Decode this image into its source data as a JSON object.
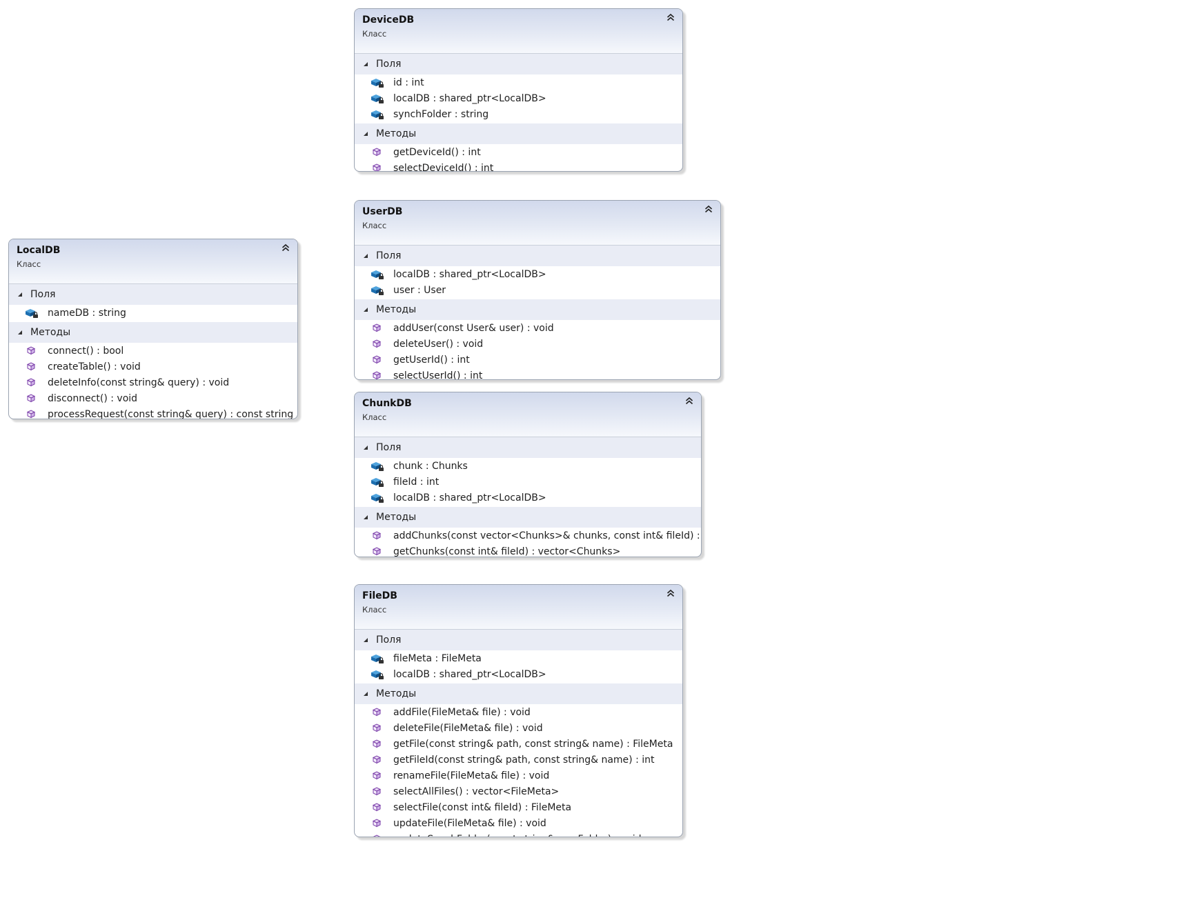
{
  "classes": {
    "devicedb": {
      "name": "DeviceDB",
      "kind": "Класс",
      "fields_label": "Поля",
      "methods_label": "Методы",
      "fields": [
        "id : int",
        "localDB : shared_ptr<LocalDB>",
        "synchFolder : string"
      ],
      "methods": [
        "getDeviceId() : int",
        "selectDeviceId() : int"
      ]
    },
    "userdb": {
      "name": "UserDB",
      "kind": "Класс",
      "fields_label": "Поля",
      "methods_label": "Методы",
      "fields": [
        "localDB : shared_ptr<LocalDB>",
        "user : User"
      ],
      "methods": [
        "addUser(const User& user) : void",
        "deleteUser() : void",
        "getUserId() : int",
        "selectUserId() : int"
      ]
    },
    "localdb": {
      "name": "LocalDB",
      "kind": "Класс",
      "fields_label": "Поля",
      "methods_label": "Методы",
      "fields": [
        "nameDB : string"
      ],
      "methods": [
        "connect() : bool",
        "createTable() : void",
        "deleteInfo(const string& query) : void",
        "disconnect() : void",
        "processRequest(const string& query) : const string"
      ]
    },
    "chunkdb": {
      "name": "ChunkDB",
      "kind": "Класс",
      "fields_label": "Поля",
      "methods_label": "Методы",
      "fields": [
        "chunk : Chunks",
        "fileId : int",
        "localDB : shared_ptr<LocalDB>"
      ],
      "methods": [
        "addChunks(const vector<Chunks>& chunks, const int& fileId) : void",
        "getChunks(const int& fileId) : vector<Chunks>"
      ]
    },
    "filedb": {
      "name": "FileDB",
      "kind": "Класс",
      "fields_label": "Поля",
      "methods_label": "Методы",
      "fields": [
        "fileMeta : FileMeta",
        "localDB : shared_ptr<LocalDB>"
      ],
      "methods": [
        "addFile(FileMeta& file) : void",
        "deleteFile(FileMeta& file) : void",
        "getFile(const string& path, const string& name) : FileMeta",
        "getFileId(const string& path, const string& name) : int",
        "renameFile(FileMeta& file) : void",
        "selectAllFiles() : vector<FileMeta>",
        "selectFile(const int& fileId) : FileMeta",
        "updateFile(FileMeta& file) : void",
        "updateSynchFolder(const string& newFolder) : void"
      ]
    }
  },
  "icons": {
    "field": "private-field-icon",
    "method": "method-icon",
    "collapse": "collapse-chevron-icon",
    "section": "section-expander-triangle-icon"
  },
  "colors": {
    "header_gradient_top": "#d1d9ec",
    "section_band": "#e9ecf5",
    "border": "#9aa3b1",
    "field_icon": "#1d6fb0",
    "method_icon": "#7a3ea8"
  }
}
